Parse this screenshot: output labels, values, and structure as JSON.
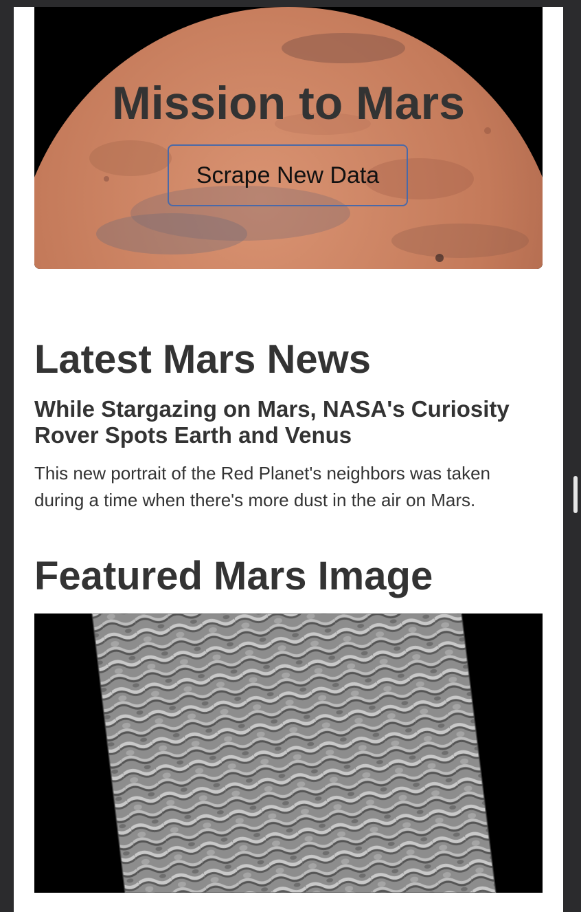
{
  "hero": {
    "title": "Mission to Mars",
    "button_label": "Scrape New Data"
  },
  "news": {
    "section_title": "Latest Mars News",
    "headline": "While Stargazing on Mars, NASA's Curiosity Rover Spots Earth and Venus",
    "teaser": "This new portrait of the Red Planet's neighbors was taken during a time when there's more dust in the air on Mars."
  },
  "featured": {
    "section_title": "Featured Mars Image"
  },
  "colors": {
    "text": "#333333",
    "button_border": "#4a69a8",
    "mars": "#c47a5a",
    "chrome": "#2b2b2d"
  }
}
